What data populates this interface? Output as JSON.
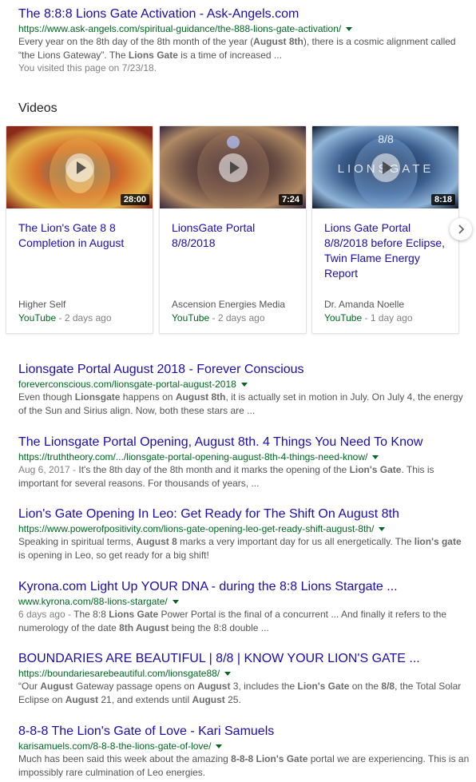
{
  "top_result": {
    "title": "The 8:8:8 Lions Gate Activation - Ask-Angels.com",
    "url": "https://www.ask-angels.com/spiritual-guidance/the-888-lions-gate-activation/",
    "snippet": [
      {
        "t": "Every year on the 8th day of the 8th month of the year ("
      },
      {
        "t": "August 8th",
        "b": true
      },
      {
        "t": "), there is a cosmic alignment called “the Lions Gateway”. The "
      },
      {
        "t": "Lions Gate",
        "b": true
      },
      {
        "t": " is a time of increased ..."
      }
    ],
    "visited": "You visited this page on 7/23/18."
  },
  "videos": {
    "heading": "Videos",
    "cards": [
      {
        "title": "The Lion's Gate 8 8 Completion in August",
        "duration": "28:00",
        "channel": "Higher Self",
        "source": "YouTube",
        "age": " - 2 days ago",
        "thumb_colors": [
          "#2f6a86",
          "#d46a2a",
          "#e2b548",
          "#8a2a1a"
        ]
      },
      {
        "title": "LionsGate Portal 8/8/2018",
        "duration": "7:24",
        "channel": "Ascension Energies Media",
        "source": "YouTube",
        "age": " - 2 days ago",
        "thumb_colors": [
          "#241a30",
          "#6a4e44",
          "#b08a64",
          "#3a2a40"
        ]
      },
      {
        "title": "Lions Gate Portal 8/8/2018 before Eclipse, Twin Flame Energy Report",
        "duration": "8:18",
        "channel": "Dr. Amanda Noelle",
        "source": "YouTube",
        "age": " - 1 day ago",
        "thumb_colors": [
          "#0d1a2e",
          "#3c5f8e",
          "#8fb4d8",
          "#101c30"
        ],
        "overlay_top": "8/8",
        "overlay_word": "LIONSGATE"
      }
    ]
  },
  "results": [
    {
      "title": "Lionsgate Portal August 2018 - Forever Conscious",
      "url": "foreverconscious.com/lionsgate-portal-august-2018",
      "snippet": [
        {
          "t": "Even though "
        },
        {
          "t": "Lionsgate",
          "b": true
        },
        {
          "t": " happens on "
        },
        {
          "t": "August 8th",
          "b": true
        },
        {
          "t": ", it is actually set in motion in July. On July 4, the energy of the Sun and Sirius align. Now, both these stars are ..."
        }
      ]
    },
    {
      "title": "The Lionsgate Portal Opening, August 8th. 4 Things You Need To Know",
      "url": "https://truththeory.com/.../lionsgate-portal-opening-august-8th-4-things-need-know/",
      "snippet": [
        {
          "t": "Aug 6, 2017 - ",
          "d": true
        },
        {
          "t": "It's the 8th day of the 8th month and it marks the opening of the "
        },
        {
          "t": "Lion's Gate",
          "b": true
        },
        {
          "t": ". This is important for several reasons. For thousands of years, ..."
        }
      ]
    },
    {
      "title": "Lion's Gate Opening In Leo: Get Ready for The Shift On August 8th",
      "url": "https://www.powerofpositivity.com/lions-gate-opening-leo-get-ready-shift-august-8th/",
      "snippet": [
        {
          "t": "Speaking in spiritual terms, "
        },
        {
          "t": "August 8",
          "b": true
        },
        {
          "t": " marks a very important day for us all energetically. The "
        },
        {
          "t": "lion's gate",
          "b": true
        },
        {
          "t": " is opening in Leo, so get ready for a big shift!"
        }
      ]
    },
    {
      "title": "Kyrona.com Light Up YOUR DNA - during the 8:8 Lions Stargate ...",
      "url": "www.kyrona.com/88-lions-stargate/",
      "snippet": [
        {
          "t": "6 days ago - ",
          "d": true
        },
        {
          "t": "The 8:8 "
        },
        {
          "t": "Lions Gate",
          "b": true
        },
        {
          "t": " Power Portal is the final of a concurrent ... And finally it refers to the numerology of the date "
        },
        {
          "t": "8th August",
          "b": true
        },
        {
          "t": " being the 8:8 double ..."
        }
      ]
    },
    {
      "title": "BOUNDARIES ARE BEAUTIFUL | 8/8 | KNOW YOUR LION'S GATE ...",
      "url": "https://boundariesarebeautiful.com/lionsgate88/",
      "snippet": [
        {
          "t": "“Our "
        },
        {
          "t": "August",
          "b": true
        },
        {
          "t": " Gateway passage opens on "
        },
        {
          "t": "August",
          "b": true
        },
        {
          "t": " 3, includes the "
        },
        {
          "t": "Lion's Gate",
          "b": true
        },
        {
          "t": " on the "
        },
        {
          "t": "8/8",
          "b": true
        },
        {
          "t": ", the Total Solar Eclipse on "
        },
        {
          "t": "August",
          "b": true
        },
        {
          "t": " 21, and extends until "
        },
        {
          "t": "August",
          "b": true
        },
        {
          "t": " 25."
        }
      ]
    },
    {
      "title": "8-8-8 The Lion's Gate of Love - Kari Samuels",
      "url": "karisamuels.com/8-8-8-the-lions-gate-of-love/",
      "snippet": [
        {
          "t": "Much has been said this week about the amazing "
        },
        {
          "t": "8-8-8 Lion's Gate",
          "b": true
        },
        {
          "t": " portal we are experiencing. This is an impossibly rare culmination of Leo energies."
        }
      ]
    }
  ],
  "icons": {
    "next": "chevron-right-icon",
    "play": "play-icon",
    "dropdown": "caret-down-icon"
  }
}
